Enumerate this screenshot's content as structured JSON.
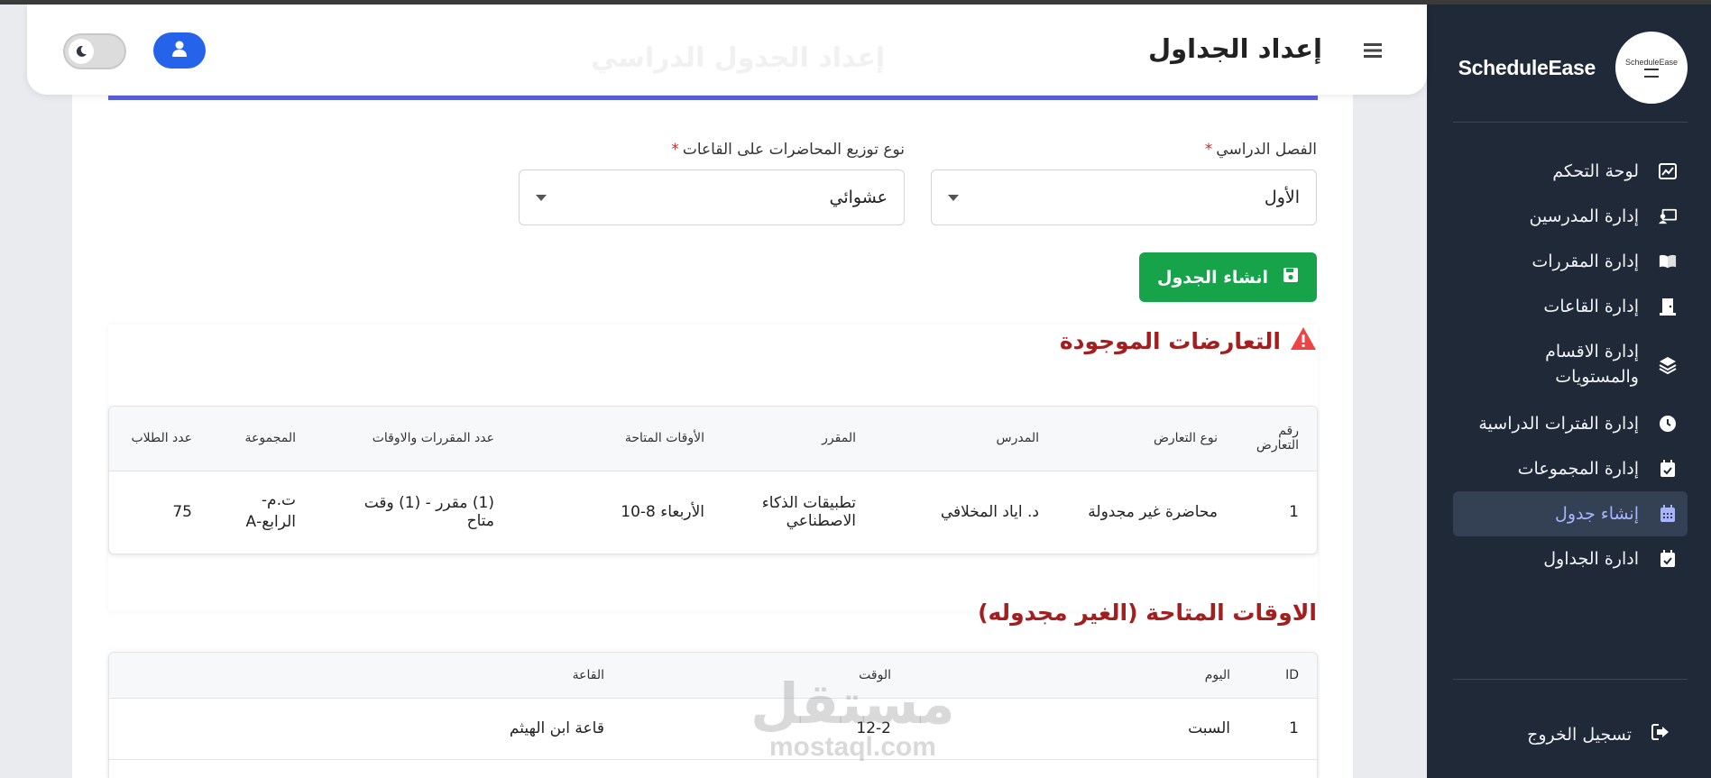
{
  "app": {
    "brand": "ScheduleEase",
    "logo_text": "ScheduleEase"
  },
  "header": {
    "title": "إعداد الجداول",
    "ghost_title": "إعداد الجدول الدراسي"
  },
  "sidebar": {
    "items": [
      {
        "label": "لوحة التحكم",
        "icon": "chart-icon"
      },
      {
        "label": "إدارة المدرسين",
        "icon": "teacher-icon"
      },
      {
        "label": "إدارة المقررات",
        "icon": "book-icon"
      },
      {
        "label": "إدارة القاعات",
        "icon": "door-icon"
      },
      {
        "label": "إدارة الاقسام والمستويات",
        "icon": "layers-icon"
      },
      {
        "label": "إدارة الفترات الدراسية",
        "icon": "clock-icon"
      },
      {
        "label": "إدارة المجموعات",
        "icon": "calendar-check-icon"
      },
      {
        "label": "إنشاء جدول",
        "icon": "calendar-icon"
      },
      {
        "label": "ادارة الجداول",
        "icon": "calendar-check-icon"
      }
    ],
    "active_index": 7,
    "logout": "تسجيل الخروج"
  },
  "form": {
    "semester_label": "الفصل الدراسي",
    "semester_value": "الأول",
    "distribution_label": "نوع توزيع المحاضرات على القاعات",
    "distribution_value": "عشوائي",
    "required_mark": "*",
    "create_button": "انشاء الجدول"
  },
  "conflicts": {
    "title": "التعارضات الموجودة",
    "columns": [
      "رقم التعارض",
      "نوع التعارض",
      "المدرس",
      "المقرر",
      "الأوقات المتاحة",
      "عدد المقررات والاوقات",
      "المجموعة",
      "عدد الطلاب"
    ],
    "rows": [
      [
        "1",
        "محاضرة غير مجدولة",
        "د. اياد المخلافي",
        "تطبيقات الذكاء الاصطناعي",
        "الأربعاء 8-10",
        "(1) مقرر - (1) وقت متاح",
        "ت.م- الرابع-A",
        "75"
      ]
    ]
  },
  "available": {
    "title": "الاوقات المتاحة (الغير مجدوله)",
    "columns": [
      "ID",
      "اليوم",
      "الوقت",
      "القاعة"
    ],
    "rows": [
      [
        "1",
        "السبت",
        "12-2",
        "قاعة ابن الهيثم"
      ]
    ]
  },
  "watermark": {
    "ar": "مستقل",
    "en": "mostaql.com"
  },
  "colors": {
    "sidebar_bg": "#1f2937",
    "accent": "#5b5fdb",
    "success": "#16a34a",
    "danger": "#a31f1f",
    "primary": "#2563eb"
  }
}
